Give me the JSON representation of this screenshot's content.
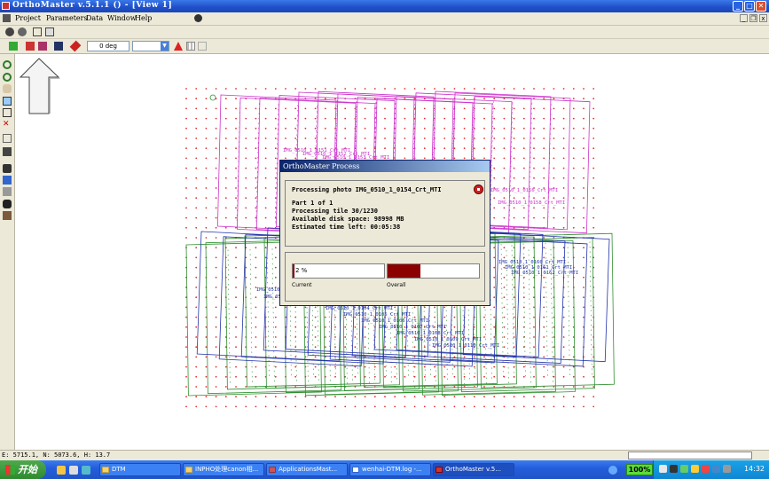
{
  "window": {
    "title": "OrthoMaster v.5.1.1 () - [View 1]",
    "minimize_icon": "minimize-icon",
    "maximize_icon": "maximize-icon",
    "close_icon": "close-icon"
  },
  "menu": {
    "items": [
      {
        "label": "Project"
      },
      {
        "label": "Parameters"
      },
      {
        "label": "Data"
      },
      {
        "label": "Window"
      },
      {
        "label": "Help"
      }
    ]
  },
  "toolbar": {
    "angle_value": "0 deg",
    "layer_select_value": ""
  },
  "map": {
    "grid_color": "#e03030",
    "photo_footprint_colors": [
      "#cc33cc",
      "#2f8f2f",
      "#2233aa"
    ],
    "labels_upper": [
      "IMG_0510_1_0151_Crt_MTI",
      "IMG_0510_1_0152_Crt_MTI",
      "IMG_0510_1_0153_Crt_MTI"
    ],
    "labels_right": [
      "IMG_0510_1_0156_Crt_MTI",
      "IMG_0510_1_0158_Crt_MTI"
    ],
    "labels_lower_right": [
      "IMG_0510_1_0160_Crt_MTI",
      "IMG_0510_1_0161_Crt_MTI",
      "IMG_0510_1_0162_Crt_MTI"
    ],
    "labels_left": [
      "IMG_0510_1_0187_Crt_MTI",
      "IMG_0510_1_0188_Crt_MTI"
    ],
    "labels_bottom": [
      "IMG_0510_1_0104_Crt_MTI",
      "IMG_0510_1_0105_Crt_MTI",
      "IMG_0510_1_0106_Crt_MTI",
      "IMG_0510_1_0107_Crt_MTI",
      "IMG_0510_1_0108_Crt_MTI",
      "IMG_0510_1_0109_Crt_MTI",
      "IMG_0510_1_0110_Crt_MTI"
    ]
  },
  "dialog": {
    "title": "OrthoMaster Process",
    "processing_photo": "Processing photo IMG_0510_1_0154_Crt_MTI",
    "part": "Part 1 of 1",
    "tile": "Processing tile 30/1230",
    "disk": "Available disk space: 98998 MB",
    "time_left": "Estimated time left: 00:05:38",
    "current_label": "Current",
    "current_text": "2 %",
    "current_progress": 0.02,
    "overall_label": "Overall",
    "overall_progress": 0.36,
    "progress_color": "#8b0000"
  },
  "statusbar": {
    "coords": "E: 5715.1, N: 5073.6, H: 13.7"
  },
  "taskbar": {
    "start_label": "开始",
    "tasks": [
      {
        "label": "DTM",
        "active": false
      },
      {
        "label": "INPHO处理canon相...",
        "active": false
      },
      {
        "label": "ApplicationsMast...",
        "active": false
      },
      {
        "label": "wenhai-DTM.log -...",
        "active": false
      },
      {
        "label": "OrthoMaster v.5...",
        "active": true
      }
    ],
    "battery": "100%",
    "clock": "14:32"
  }
}
